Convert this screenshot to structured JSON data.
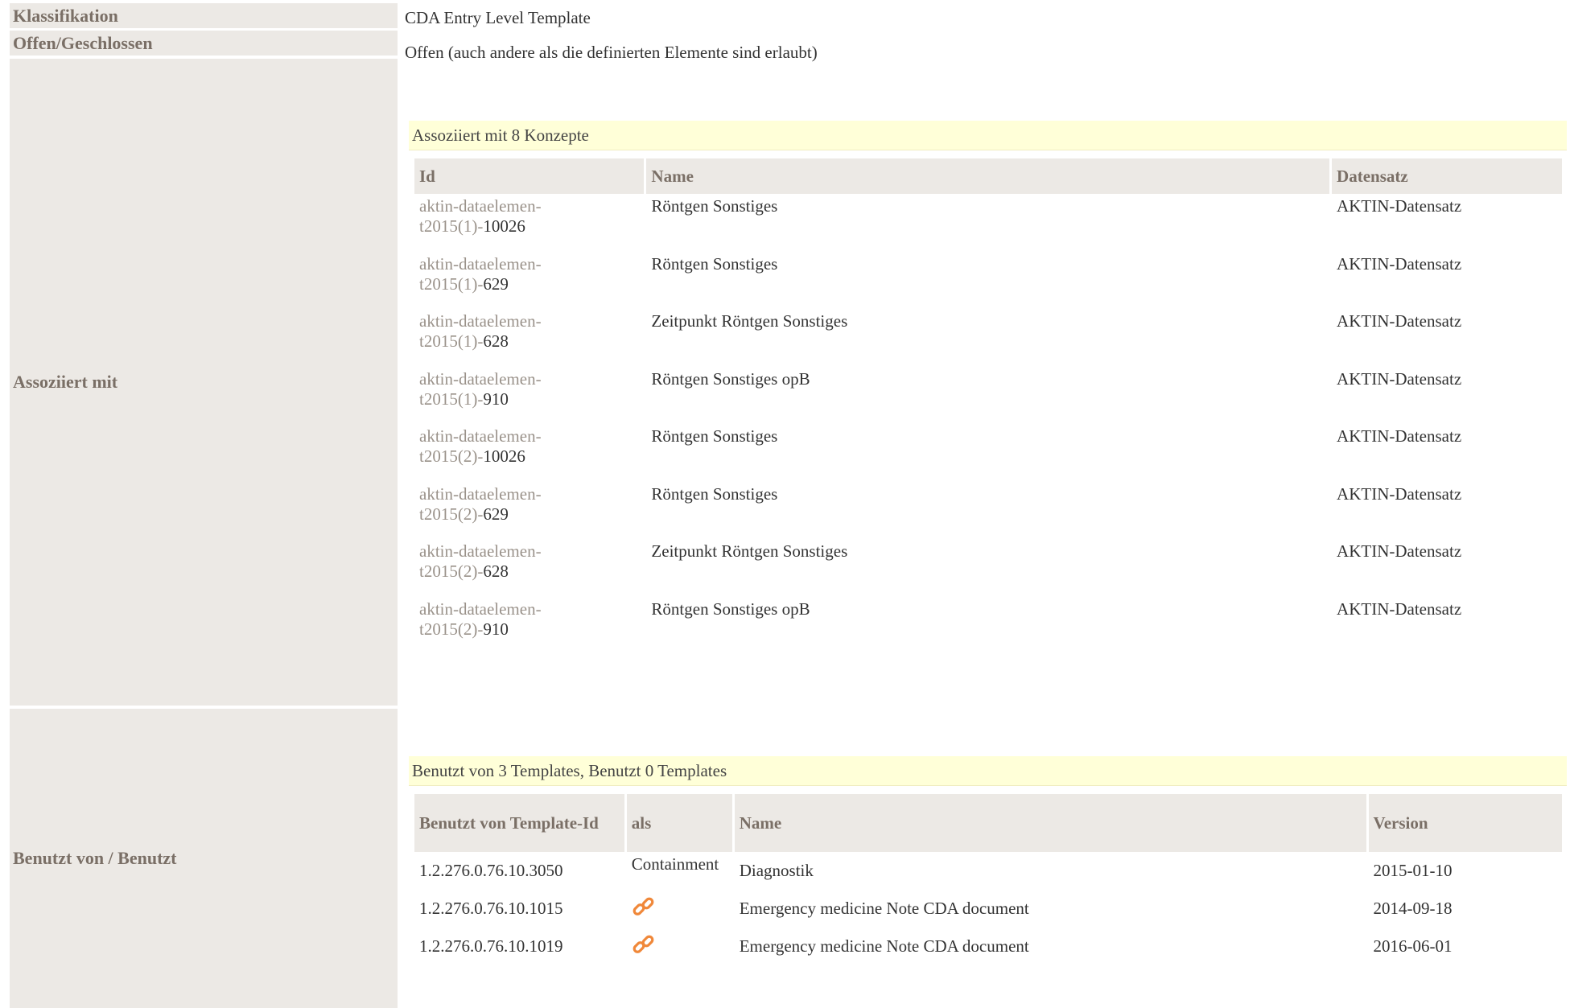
{
  "rows": {
    "classification": {
      "label": "Klassifikation",
      "value": "CDA Entry Level Template"
    },
    "open_closed": {
      "label": "Offen/Geschlossen",
      "value": "Offen (auch andere als die definierten Elemente sind erlaubt)"
    },
    "associated": {
      "label": "Assoziiert mit"
    },
    "used_by": {
      "label": "Benutzt von / Benutzt"
    }
  },
  "concepts": {
    "title": "Assoziiert mit 8 Konzepte",
    "headers": {
      "id": "Id",
      "name": "Name",
      "dataset": "Datensatz"
    },
    "items": [
      {
        "id_line1": "aktin-dataelemen-",
        "id_prefix": "t2015(1)-",
        "id_num": "10026",
        "name": "Röntgen Sonstiges",
        "dataset": "AKTIN-Datensatz"
      },
      {
        "id_line1": "aktin-dataelemen-",
        "id_prefix": "t2015(1)-",
        "id_num": "629",
        "name": "Röntgen Sonstiges",
        "dataset": "AKTIN-Datensatz"
      },
      {
        "id_line1": "aktin-dataelemen-",
        "id_prefix": "t2015(1)-",
        "id_num": "628",
        "name": "Zeitpunkt Röntgen Sonstiges",
        "dataset": "AKTIN-Datensatz"
      },
      {
        "id_line1": "aktin-dataelemen-",
        "id_prefix": "t2015(1)-",
        "id_num": "910",
        "name": "Röntgen Sonstiges opB",
        "dataset": "AKTIN-Datensatz"
      },
      {
        "id_line1": "aktin-dataelemen-",
        "id_prefix": "t2015(2)-",
        "id_num": "10026",
        "name": "Röntgen Sonstiges",
        "dataset": "AKTIN-Datensatz"
      },
      {
        "id_line1": "aktin-dataelemen-",
        "id_prefix": "t2015(2)-",
        "id_num": "629",
        "name": "Röntgen Sonstiges",
        "dataset": "AKTIN-Datensatz"
      },
      {
        "id_line1": "aktin-dataelemen-",
        "id_prefix": "t2015(2)-",
        "id_num": "628",
        "name": "Zeitpunkt Röntgen Sonstiges",
        "dataset": "AKTIN-Datensatz"
      },
      {
        "id_line1": "aktin-dataelemen-",
        "id_prefix": "t2015(2)-",
        "id_num": "910",
        "name": "Röntgen Sonstiges opB",
        "dataset": "AKTIN-Datensatz"
      }
    ]
  },
  "templates": {
    "title": "Benutzt von 3 Templates, Benutzt 0 Templates",
    "headers": {
      "id": "Benutzt von Template-Id",
      "as": "als",
      "name": "Name",
      "version": "Version"
    },
    "items": [
      {
        "id": "1.2.276.0.76.10.3050",
        "as": "Containment",
        "as_icon": "",
        "name": "Diagnostik",
        "version": "2015-01-10"
      },
      {
        "id": "1.2.276.0.76.10.1015",
        "as": "",
        "as_icon": "link-icon",
        "name": "Emergency medicine Note CDA document",
        "version": "2014-09-18"
      },
      {
        "id": "1.2.276.0.76.10.1019",
        "as": "",
        "as_icon": "link-icon",
        "name": "Emergency medicine Note CDA document",
        "version": "2016-06-01"
      }
    ]
  },
  "colors": {
    "label_bg": "#ece9e5",
    "label_text": "#7a6f66",
    "box_title_bg": "#ffffd8",
    "icon_orange": "#f0883a"
  }
}
